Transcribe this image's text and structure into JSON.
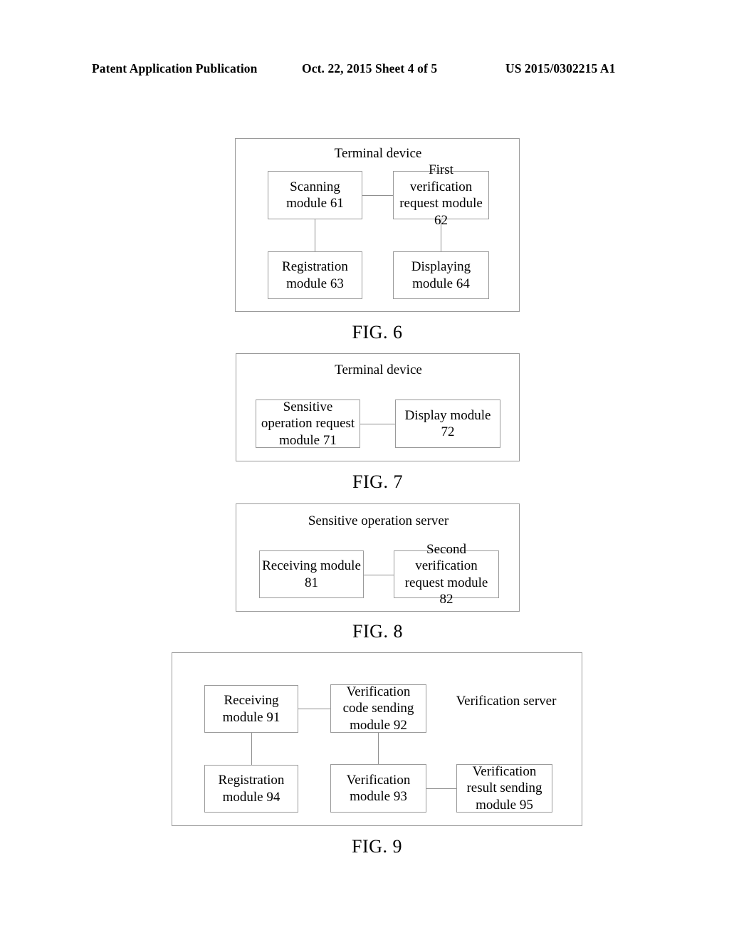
{
  "header": {
    "left": "Patent Application Publication",
    "middle": "Oct. 22, 2015  Sheet 4 of 5",
    "right": "US 2015/0302215 A1"
  },
  "figures": [
    {
      "caption": "FIG. 6",
      "container_title": "Terminal device",
      "modules": [
        {
          "id": "61",
          "label": "Scanning\nmodule 61",
          "line1": "Scanning",
          "line2": "module 61",
          "line3": ""
        },
        {
          "id": "62",
          "label": "First verification request module 62",
          "line1": "First verification",
          "line2": "request module",
          "line3": "62"
        },
        {
          "id": "63",
          "label": "Registration module 63",
          "line1": "Registration",
          "line2": "module 63",
          "line3": ""
        },
        {
          "id": "64",
          "label": "Displaying module 64",
          "line1": "Displaying",
          "line2": "module 64",
          "line3": ""
        }
      ]
    },
    {
      "caption": "FIG. 7",
      "container_title": "Terminal device",
      "modules": [
        {
          "id": "71",
          "label": "Sensitive operation request module 71",
          "line1": "Sensitive",
          "line2": "operation request",
          "line3": "module 71"
        },
        {
          "id": "72",
          "label": "Display module 72",
          "line1": "Display module",
          "line2": "72",
          "line3": ""
        }
      ]
    },
    {
      "caption": "FIG. 8",
      "container_title": "Sensitive operation server",
      "modules": [
        {
          "id": "81",
          "label": "Receiving module 81",
          "line1": "Receiving module",
          "line2": "81",
          "line3": ""
        },
        {
          "id": "82",
          "label": "Second verification request module 82",
          "line1": "Second",
          "line2": "verification",
          "line3": "request module 82"
        }
      ]
    },
    {
      "caption": "FIG. 9",
      "container_title": "Verification server",
      "modules": [
        {
          "id": "91",
          "label": "Receiving module 91",
          "line1": "Receiving",
          "line2": "module 91",
          "line3": ""
        },
        {
          "id": "92",
          "label": "Verification code sending module 92",
          "line1": "Verification",
          "line2": "code sending",
          "line3": "module 92"
        },
        {
          "id": "93",
          "label": "Verification module 93",
          "line1": "Verification",
          "line2": "module 93",
          "line3": ""
        },
        {
          "id": "94",
          "label": "Registration module 94",
          "line1": "Registration",
          "line2": "module 94",
          "line3": ""
        },
        {
          "id": "95",
          "label": "Verification result sending module 95",
          "line1": "Verification",
          "line2": "result sending",
          "line3": "module 95"
        }
      ]
    }
  ],
  "colors": {
    "page_background": "#ffffff",
    "ink": "#000000",
    "box_stroke": "#9a9a9a",
    "connector_stroke": "#8f8f8f"
  }
}
